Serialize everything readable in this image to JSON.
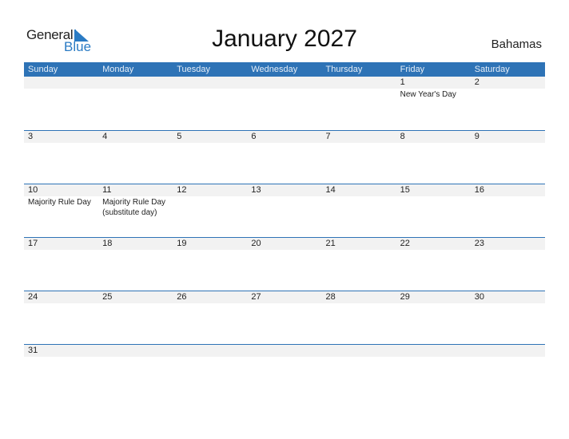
{
  "logo": {
    "general": "General",
    "blue": "Blue"
  },
  "title": "January 2027",
  "country": "Bahamas",
  "colors": {
    "accent": "#2e73b6",
    "strip": "#f2f2f2",
    "logo_blue": "#2a7bc4"
  },
  "weekdays": [
    "Sunday",
    "Monday",
    "Tuesday",
    "Wednesday",
    "Thursday",
    "Friday",
    "Saturday"
  ],
  "weeks": [
    [
      {
        "d": ""
      },
      {
        "d": ""
      },
      {
        "d": ""
      },
      {
        "d": ""
      },
      {
        "d": ""
      },
      {
        "d": "1",
        "e": "New Year's Day"
      },
      {
        "d": "2"
      }
    ],
    [
      {
        "d": "3"
      },
      {
        "d": "4"
      },
      {
        "d": "5"
      },
      {
        "d": "6"
      },
      {
        "d": "7"
      },
      {
        "d": "8"
      },
      {
        "d": "9"
      }
    ],
    [
      {
        "d": "10",
        "e": "Majority Rule Day"
      },
      {
        "d": "11",
        "e": "Majority Rule Day (substitute day)"
      },
      {
        "d": "12"
      },
      {
        "d": "13"
      },
      {
        "d": "14"
      },
      {
        "d": "15"
      },
      {
        "d": "16"
      }
    ],
    [
      {
        "d": "17"
      },
      {
        "d": "18"
      },
      {
        "d": "19"
      },
      {
        "d": "20"
      },
      {
        "d": "21"
      },
      {
        "d": "22"
      },
      {
        "d": "23"
      }
    ],
    [
      {
        "d": "24"
      },
      {
        "d": "25"
      },
      {
        "d": "26"
      },
      {
        "d": "27"
      },
      {
        "d": "28"
      },
      {
        "d": "29"
      },
      {
        "d": "30"
      }
    ],
    [
      {
        "d": "31"
      },
      {
        "d": ""
      },
      {
        "d": ""
      },
      {
        "d": ""
      },
      {
        "d": ""
      },
      {
        "d": ""
      },
      {
        "d": ""
      }
    ]
  ]
}
